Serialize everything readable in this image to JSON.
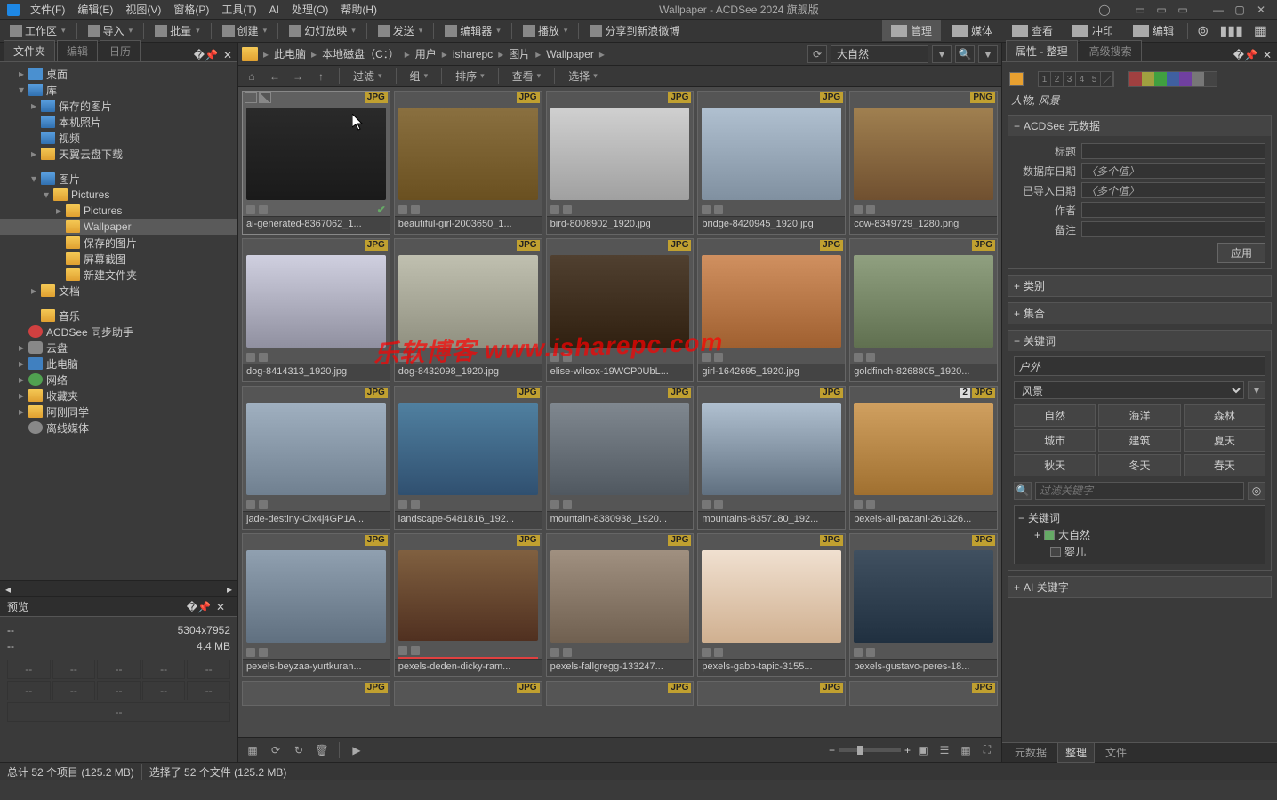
{
  "app": {
    "title": "Wallpaper - ACDSee 2024 旗舰版"
  },
  "menubar": [
    "文件(F)",
    "编辑(E)",
    "视图(V)",
    "窗格(P)",
    "工具(T)",
    "AI",
    "处理(O)",
    "帮助(H)"
  ],
  "toolbar": {
    "workspace": "工作区",
    "import": "导入",
    "batch": "批量",
    "create": "创建",
    "slideshow": "幻灯放映",
    "send": "发送",
    "editor": "编辑器",
    "play": "播放",
    "share": "分享到新浪微博"
  },
  "modes": {
    "manage": "管理",
    "media": "媒体",
    "view": "查看",
    "print": "冲印",
    "edit": "编辑"
  },
  "left": {
    "tabs": {
      "folders": "文件夹",
      "edit": "编辑",
      "calendar": "日历"
    },
    "tree": [
      {
        "d": 1,
        "tw": "▸",
        "icon": "desktop",
        "label": "桌面"
      },
      {
        "d": 1,
        "tw": "▾",
        "icon": "folder-blue",
        "label": "库"
      },
      {
        "d": 2,
        "tw": "▸",
        "icon": "pic",
        "label": "保存的图片"
      },
      {
        "d": 2,
        "tw": "",
        "icon": "pic",
        "label": "本机照片"
      },
      {
        "d": 2,
        "tw": "",
        "icon": "pic",
        "label": "视频"
      },
      {
        "d": 2,
        "tw": "▸",
        "icon": "folder",
        "label": "天翼云盘下载"
      },
      {
        "d": 2,
        "tw": "▾",
        "icon": "pic",
        "label": "图片"
      },
      {
        "d": 3,
        "tw": "▾",
        "icon": "folder",
        "label": "Pictures"
      },
      {
        "d": 4,
        "tw": "▸",
        "icon": "folder",
        "label": "Pictures"
      },
      {
        "d": 4,
        "tw": "",
        "icon": "folder",
        "label": "Wallpaper",
        "sel": true
      },
      {
        "d": 4,
        "tw": "",
        "icon": "folder",
        "label": "保存的图片"
      },
      {
        "d": 4,
        "tw": "",
        "icon": "folder",
        "label": "屏幕截图"
      },
      {
        "d": 4,
        "tw": "",
        "icon": "folder",
        "label": "新建文件夹"
      },
      {
        "d": 2,
        "tw": "▸",
        "icon": "folder",
        "label": "文档"
      },
      {
        "d": 2,
        "tw": "",
        "icon": "folder",
        "label": "音乐"
      },
      {
        "d": 1,
        "tw": "",
        "icon": "red",
        "label": "ACDSee 同步助手"
      },
      {
        "d": 1,
        "tw": "▸",
        "icon": "cloud",
        "label": "云盘"
      },
      {
        "d": 1,
        "tw": "▸",
        "icon": "pc",
        "label": "此电脑"
      },
      {
        "d": 1,
        "tw": "▸",
        "icon": "net",
        "label": "网络"
      },
      {
        "d": 1,
        "tw": "▸",
        "icon": "folder",
        "label": "收藏夹"
      },
      {
        "d": 1,
        "tw": "▸",
        "icon": "folder",
        "label": "阿刚同学"
      },
      {
        "d": 1,
        "tw": "",
        "icon": "disc",
        "label": "离线媒体"
      }
    ],
    "preview": {
      "title": "预览",
      "dim": "5304x7952",
      "size": "4.4 MB",
      "dash": "--"
    }
  },
  "crumb": [
    "此电脑",
    "本地磁盘（C：）",
    "用户",
    "isharepc",
    "图片",
    "Wallpaper"
  ],
  "search": {
    "value": "大自然"
  },
  "viewbar": {
    "filter": "过滤",
    "group": "组",
    "sort": "排序",
    "view": "查看",
    "select": "选择"
  },
  "thumbs": [
    {
      "ext": "JPG",
      "name": "ai-generated-8367062_1...",
      "sel": true,
      "ctrl": true,
      "bg": "linear-gradient(#2a2a2a,#1a1a1a)"
    },
    {
      "ext": "JPG",
      "name": "beautiful-girl-2003650_1...",
      "bg": "linear-gradient(#8a7040,#6a5020)"
    },
    {
      "ext": "JPG",
      "name": "bird-8008902_1920.jpg",
      "bg": "linear-gradient(#d0d0d0,#a0a0a0)"
    },
    {
      "ext": "JPG",
      "name": "bridge-8420945_1920.jpg",
      "bg": "linear-gradient(#b0c0d0,#8090a0)"
    },
    {
      "ext": "PNG",
      "name": "cow-8349729_1280.png",
      "bg": "linear-gradient(#a08050,#705030)"
    },
    {
      "ext": "JPG",
      "name": "dog-8414313_1920.jpg",
      "bg": "linear-gradient(#d0d0e0,#9090a0)"
    },
    {
      "ext": "JPG",
      "name": "dog-8432098_1920.jpg",
      "bg": "linear-gradient(#c0c0b0,#909080)"
    },
    {
      "ext": "JPG",
      "name": "elise-wilcox-19WCP0UbL...",
      "bg": "linear-gradient(#504030,#302010)"
    },
    {
      "ext": "JPG",
      "name": "girl-1642695_1920.jpg",
      "bg": "linear-gradient(#d09060,#a06030)"
    },
    {
      "ext": "JPG",
      "name": "goldfinch-8268805_1920...",
      "bg": "linear-gradient(#90a080,#607050)"
    },
    {
      "ext": "JPG",
      "name": "jade-destiny-Cix4j4GP1A...",
      "bg": "linear-gradient(#a0b0c0,#708090)"
    },
    {
      "ext": "JPG",
      "name": "landscape-5481816_192...",
      "bg": "linear-gradient(#5080a0,#305070)"
    },
    {
      "ext": "JPG",
      "name": "mountain-8380938_1920...",
      "bg": "linear-gradient(#808890,#505860)"
    },
    {
      "ext": "JPG",
      "name": "mountains-8357180_192...",
      "bg": "linear-gradient(#b0c0d0,#607080)"
    },
    {
      "ext": "JPG",
      "name": "pexels-ali-pazani-261326...",
      "badge2": "2",
      "bg": "linear-gradient(#d0a060,#a07030)"
    },
    {
      "ext": "JPG",
      "name": "pexels-beyzaa-yurtkuran...",
      "bg": "linear-gradient(#90a0b0,#607080)"
    },
    {
      "ext": "JPG",
      "name": "pexels-deden-dicky-ram...",
      "underline": true,
      "bg": "linear-gradient(#806040,#503020)"
    },
    {
      "ext": "JPG",
      "name": "pexels-fallgregg-133247...",
      "bg": "linear-gradient(#a09080,#706050)"
    },
    {
      "ext": "JPG",
      "name": "pexels-gabb-tapic-3155...",
      "bg": "linear-gradient(#f0e0d0,#d0b090)"
    },
    {
      "ext": "JPG",
      "name": "pexels-gustavo-peres-18...",
      "bg": "linear-gradient(#405060,#203040)"
    },
    {
      "ext": "JPG",
      "name": "",
      "partial": true
    },
    {
      "ext": "JPG",
      "name": "",
      "partial": true
    },
    {
      "ext": "JPG",
      "name": "",
      "partial": true
    },
    {
      "ext": "JPG",
      "name": "",
      "partial": true
    },
    {
      "ext": "JPG",
      "name": "",
      "partial": true
    }
  ],
  "right": {
    "tabs": {
      "props": "属性 - 整理",
      "adv": "高级搜索"
    },
    "tag_labels": "人物, 风景",
    "meta": {
      "title": "ACDSee 元数据",
      "rows": [
        {
          "l": "标题",
          "v": ""
        },
        {
          "l": "数据库日期",
          "v": "〈多个值〉"
        },
        {
          "l": "已导入日期",
          "v": "〈多个值〉"
        },
        {
          "l": "作者",
          "v": ""
        },
        {
          "l": "备注",
          "v": ""
        }
      ],
      "apply": "应用"
    },
    "sections": {
      "category": "类别",
      "collection": "集合",
      "keywords": "关键词",
      "ai": "AI 关键字"
    },
    "keywords": {
      "input": "户外",
      "select": "风景",
      "quick": [
        "自然",
        "海洋",
        "森林",
        "城市",
        "建筑",
        "夏天",
        "秋天",
        "冬天",
        "春天"
      ],
      "filter_ph": "过滤关键字",
      "tree_root": "关键词",
      "tree": [
        {
          "l": "大自然",
          "chk": true
        },
        {
          "l": "婴儿",
          "chk": false
        }
      ]
    },
    "bottom_tabs": {
      "meta": "元数据",
      "organize": "整理",
      "file": "文件"
    }
  },
  "status": {
    "total": "总计 52 个项目 (125.2 MB)",
    "sel": "选择了 52 个文件 (125.2 MB)"
  },
  "watermark": "乐软博客 www.isharepc.com"
}
